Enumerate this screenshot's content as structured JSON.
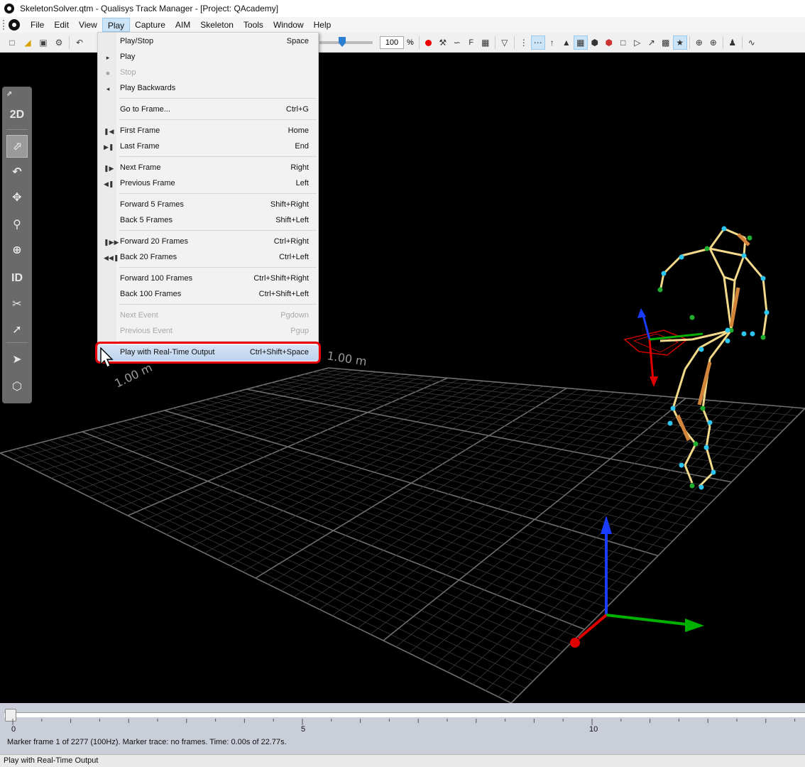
{
  "window": {
    "title": "SkeletonSolver.qtm - Qualisys Track Manager - [Project: QAcademy]"
  },
  "menubar": {
    "items": [
      {
        "label": "File"
      },
      {
        "label": "Edit"
      },
      {
        "label": "View"
      },
      {
        "label": "Play"
      },
      {
        "label": "Capture"
      },
      {
        "label": "AIM"
      },
      {
        "label": "Skeleton"
      },
      {
        "label": "Tools"
      },
      {
        "label": "Window"
      },
      {
        "label": "Help"
      }
    ],
    "active": "Play"
  },
  "toolbar": {
    "speed_value": "100",
    "speed_unit": "%"
  },
  "palette": {
    "mode_2d": "2D",
    "id_label": "ID"
  },
  "play_menu": {
    "items": [
      {
        "label": "Play/Stop",
        "shortcut": "Space",
        "icon": "",
        "disabled": false
      },
      {
        "label": "Play",
        "shortcut": "",
        "icon": "play-icon",
        "disabled": false
      },
      {
        "label": "Stop",
        "shortcut": "",
        "icon": "stop-icon",
        "disabled": true
      },
      {
        "label": "Play Backwards",
        "shortcut": "",
        "icon": "play-backwards-icon",
        "disabled": false
      },
      {
        "label": "Go to Frame...",
        "shortcut": "Ctrl+G",
        "icon": "",
        "disabled": false
      },
      {
        "label": "First Frame",
        "shortcut": "Home",
        "icon": "first-frame-icon",
        "disabled": false
      },
      {
        "label": "Last Frame",
        "shortcut": "End",
        "icon": "last-frame-icon",
        "disabled": false
      },
      {
        "label": "Next Frame",
        "shortcut": "Right",
        "icon": "next-frame-icon",
        "disabled": false
      },
      {
        "label": "Previous Frame",
        "shortcut": "Left",
        "icon": "previous-frame-icon",
        "disabled": false
      },
      {
        "label": "Forward 5 Frames",
        "shortcut": "Shift+Right",
        "icon": "",
        "disabled": false
      },
      {
        "label": "Back 5 Frames",
        "shortcut": "Shift+Left",
        "icon": "",
        "disabled": false
      },
      {
        "label": "Forward 20 Frames",
        "shortcut": "Ctrl+Right",
        "icon": "forward-20-icon",
        "disabled": false
      },
      {
        "label": "Back 20 Frames",
        "shortcut": "Ctrl+Left",
        "icon": "back-20-icon",
        "disabled": false
      },
      {
        "label": "Forward 100 Frames",
        "shortcut": "Ctrl+Shift+Right",
        "icon": "",
        "disabled": false
      },
      {
        "label": "Back 100 Frames",
        "shortcut": "Ctrl+Shift+Left",
        "icon": "",
        "disabled": false
      },
      {
        "label": "Next Event",
        "shortcut": "Pgdown",
        "icon": "",
        "disabled": true
      },
      {
        "label": "Previous Event",
        "shortcut": "Pgup",
        "icon": "",
        "disabled": true
      },
      {
        "label": "Play with Real-Time Output",
        "shortcut": "Ctrl+Shift+Space",
        "icon": "",
        "disabled": false,
        "highlighted": true
      }
    ]
  },
  "grid_labels": {
    "left": "1.00 m",
    "right": "1.00 m"
  },
  "timeline": {
    "tick_labels": [
      "0",
      "5",
      "10"
    ],
    "status": "Marker frame 1 of 2277 (100Hz). Marker trace: no frames. Time: 0.00s of 22.77s."
  },
  "statusbar": {
    "text": "Play with Real-Time Output"
  },
  "colors": {
    "highlight_ring": "#e8000b",
    "x_axis": "#e00000",
    "y_axis": "#00b000",
    "z_axis": "#1a3cff",
    "bone": "#f3d98a",
    "marker": "#2ec4f0"
  }
}
